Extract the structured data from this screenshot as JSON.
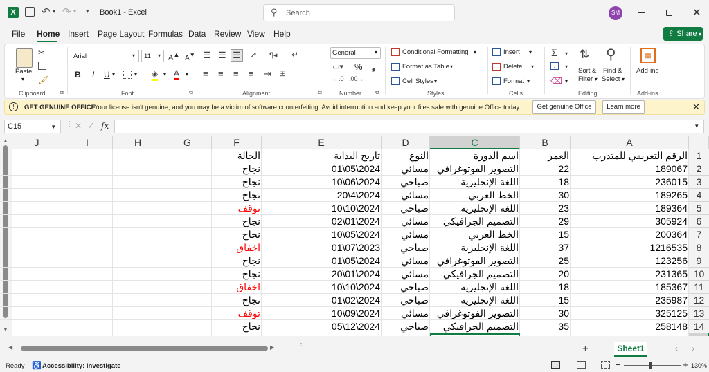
{
  "title": {
    "file_name": "Book1",
    "separator": "-",
    "app_name": "Excel",
    "search_placeholder": "Search",
    "avatar_initials": "SM"
  },
  "menu": [
    "File",
    "Home",
    "Insert",
    "Page Layout",
    "Formulas",
    "Data",
    "Review",
    "View",
    "Help"
  ],
  "share_label": "Share",
  "ribbon": {
    "clipboard": {
      "paste": "Paste",
      "label": "Clipboard"
    },
    "font": {
      "name": "Arial",
      "size": "11",
      "bold": "B",
      "italic": "I",
      "underline": "U",
      "label": "Font"
    },
    "alignment": {
      "label": "Alignment"
    },
    "number": {
      "format": "General",
      "percent": "%",
      "label": "Number"
    },
    "styles": {
      "conditional": "Conditional Formatting",
      "format_table": "Format as Table",
      "cell_styles": "Cell Styles",
      "label": "Styles"
    },
    "cells": {
      "insert": "Insert",
      "delete": "Delete",
      "format": "Format",
      "label": "Cells"
    },
    "editing": {
      "sort_1": "Sort &",
      "sort_2": "Filter",
      "find_1": "Find &",
      "find_2": "Select",
      "label": "Editing"
    },
    "addins": {
      "button": "Add-ins",
      "label": "Add-ins"
    }
  },
  "infobar": {
    "title": "GET GENUINE OFFICE",
    "message": "Your license isn't genuine, and you may be a victim of software counterfeiting. Avoid interruption and keep your files safe with genuine Office today.",
    "btn_genuine": "Get genuine Office",
    "btn_learn": "Learn more"
  },
  "formula": {
    "name_box": "C15",
    "fx": "fx",
    "content": ""
  },
  "columns": [
    "J",
    "I",
    "H",
    "G",
    "F",
    "E",
    "D",
    "C",
    "B",
    "A"
  ],
  "rows": [
    "1",
    "2",
    "3",
    "4",
    "5",
    "6",
    "7",
    "8",
    "9",
    "10",
    "11",
    "12",
    "13",
    "14",
    "15"
  ],
  "headers": {
    "A": "الرقم التعريفي للمتدرب",
    "B": "العمر",
    "C": "اسم الدورة",
    "D": "النوع",
    "E": "تاريخ البداية",
    "F": "الحالة"
  },
  "records": [
    {
      "id": "189067",
      "age": "22",
      "course": "التصوير الفوتوغرافي",
      "type": "مسائي",
      "date": "01\\05\\2024",
      "status": "نجاح",
      "status_color": "#000000"
    },
    {
      "id": "236015",
      "age": "18",
      "course": "اللغة الإنجليزية",
      "type": "صباحي",
      "date": "10\\06\\2024",
      "status": "نجاح",
      "status_color": "#000000"
    },
    {
      "id": "189265",
      "age": "30",
      "course": "الخط العربي",
      "type": "مسائي",
      "date": "20\\4\\2024",
      "status": "نجاح",
      "status_color": "#000000"
    },
    {
      "id": "189364",
      "age": "23",
      "course": "اللغة الإنجليزية",
      "type": "صباحي",
      "date": "10\\10\\2024",
      "status": "توقف",
      "status_color": "#ff0000"
    },
    {
      "id": "305924",
      "age": "29",
      "course": "التصميم الجرافيكي",
      "type": "مسائي",
      "date": "02\\01\\2024",
      "status": "نجاح",
      "status_color": "#000000"
    },
    {
      "id": "200364",
      "age": "15",
      "course": "الخط العربي",
      "type": "مسائي",
      "date": "10\\05\\2024",
      "status": "نجاح",
      "status_color": "#000000"
    },
    {
      "id": "1216535",
      "age": "37",
      "course": "اللغة الإنجليزية",
      "type": "صباحي",
      "date": "01\\07\\2023",
      "status": "اخفاق",
      "status_color": "#ff0000"
    },
    {
      "id": "123256",
      "age": "25",
      "course": "التصوير الفوتوغرافي",
      "type": "مسائي",
      "date": "01\\05\\2024",
      "status": "نجاح",
      "status_color": "#000000"
    },
    {
      "id": "231365",
      "age": "20",
      "course": "التصميم الجرافيكي",
      "type": "مسائي",
      "date": "20\\01\\2024",
      "status": "نجاح",
      "status_color": "#000000"
    },
    {
      "id": "185367",
      "age": "18",
      "course": "اللغة الإنجليزية",
      "type": "صباحي",
      "date": "10\\10\\2024",
      "status": "اخفاق",
      "status_color": "#ff0000"
    },
    {
      "id": "235987",
      "age": "15",
      "course": "اللغة الإنجليزية",
      "type": "صباحي",
      "date": "01\\02\\2024",
      "status": "نجاح",
      "status_color": "#000000"
    },
    {
      "id": "325125",
      "age": "30",
      "course": "التصوير الفوتوغرافي",
      "type": "مسائي",
      "date": "10\\09\\2024",
      "status": "توقف",
      "status_color": "#ff0000"
    },
    {
      "id": "258148",
      "age": "35",
      "course": "التصميم الجرافيكي",
      "type": "صباحي",
      "date": "05\\12\\2024",
      "status": "نجاح",
      "status_color": "#000000"
    }
  ],
  "sheet_tab": "Sheet1",
  "status": {
    "ready": "Ready",
    "accessibility": "Accessibility: Investigate",
    "zoom": "130%"
  },
  "colors": {
    "excel_green": "#107c41",
    "accent_purple": "#8e44ad",
    "status_red": "#ff0000"
  }
}
